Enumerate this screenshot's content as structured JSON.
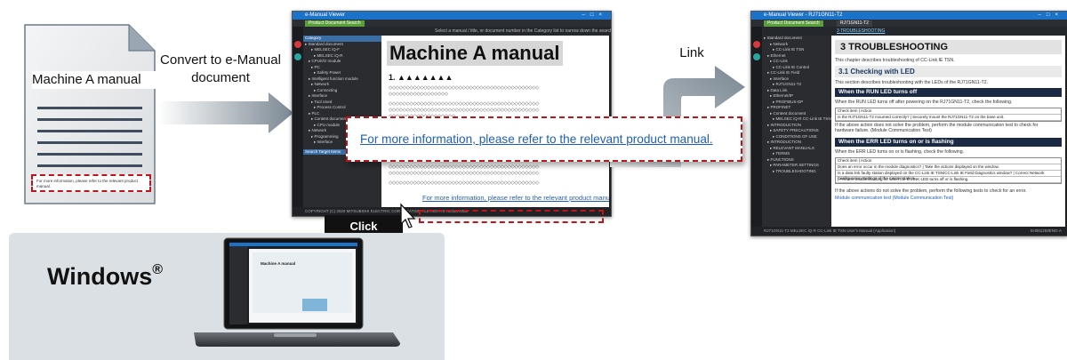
{
  "left_document": {
    "title": "Machine A manual",
    "footer_note": "For more information, please refer to the relevant product manual."
  },
  "steps": {
    "convert_label": "Convert to e-Manual document",
    "link_label": "Link",
    "click_label": "Click"
  },
  "viewer_left": {
    "window_title": "e-Manual Viewer",
    "tab_label": "Product Document Search",
    "toolbar_hint": "Select a manual / title, or document number in the Category list to narrow down the search results. Full-check search...",
    "page_title": "Machine A manual",
    "page_subtitle": "1.  ▲▲▲▲▲▲▲",
    "small_link_text": "For more information, please refer to the relevant product manual.",
    "status_text": "COPYRIGHT (C) 2020 MITSUBISHI ELECTRIC CORPORATION ALL RIGHTS RESERVED",
    "tree_header": "Category",
    "tree_items": [
      "Standard document",
      "MELSEC iQ-F",
      "MELSEC iQ-R",
      "CPU/I/O module",
      "PC",
      "Safety Power",
      "Intelligent function module",
      "Network",
      "Connecting",
      "Interface",
      "Tool Used",
      "Process Control",
      "PLC",
      "Content document",
      "CPU module",
      "Network",
      "Programming",
      "Interface"
    ],
    "tree_footer": "Search Target Items"
  },
  "callout": {
    "text": "For more information, please refer to the relevant product manual."
  },
  "viewer_right": {
    "window_title": "e-Manual Viewer - RJ71GN11-T2",
    "tab_label": "Product Document Search",
    "tab2_label": "RJ71GN11-T2",
    "breadcrumb": "3 TROUBLESHOOTING",
    "h1": "3 TROUBLESHOOTING",
    "intro": "This chapter describes troubleshooting of CC-Link IE TSN.",
    "h2": "3.1 Checking with LED",
    "p2": "This section describes troubleshooting with the LEDs of the RJ71GN11-T2.",
    "h3a": "When the RUN LED turns off",
    "p3a": "When the RUN LED turns off after powering on the RJ71GN11-T2, check the following.",
    "table_a": [
      "Check item  |  Action",
      "Is the RJ71GN11-T2 mounted correctly?  |  Securely mount the RJ71GN11-T2 on the base unit."
    ],
    "p_after_a": "If the above action does not solve the problem, perform the module communication test to check for hardware failure. (Module Communication Test)",
    "h3b": "When the ERR LED turns on or is flashing",
    "p3b": "When the ERR LED turns on or is flashing, check the following.",
    "table_b": [
      "Check item  |  Action",
      "Does an error occur in the module diagnostics?  |  Take the actions displayed on the window.",
      "Is a data link faulty station displayed on the CC-Link IE TSN/CC-Link IE Field Diagnostics window?  |  Correct Network Configuration Settings of the master station.",
      "  |  Perform troubleshooting for when the D LINK LED turns off or is flashing."
    ],
    "p_after_b": "If the above actions do not solve the problem, perform the following tests to check for an error.",
    "bullet": "Module communication test (Module Communication Test)",
    "tree_items": [
      "Standard document",
      "Network",
      "CC-Link IE TSN",
      "Ethernet",
      "CC-Link",
      "CC-Link IE Control",
      "CC-Link IE Field",
      "Interface",
      "RJ71GN11-T2",
      "Data Link",
      "Ethernet/IP",
      "PROFIBUS-DP",
      "PROFINET",
      "Content document",
      "MELSEC iQ-R CC-Link IE TSN User's Manual",
      "INTRODUCTION",
      "SAFETY PRECAUTIONS",
      "CONDITIONS OF USE",
      "INTRODUCTION",
      "RELEVANT MANUALS",
      "TERMS",
      "FUNCTIONS",
      "PARAMETER SETTINGS",
      "TROUBLESHOOTING"
    ],
    "status_text": "RJ71GN11-T2 MELSEC iQ-R CC-Link IE TSN User's Manual (Application)",
    "status_right": "SH081259ENG-A"
  },
  "windows_section": {
    "label": "Windows",
    "reg": "®",
    "laptop_screen_title": "Machine A manual"
  },
  "colors": {
    "accent_red": "#c0141b",
    "link_blue": "#1e5fb4",
    "arrow_gray": "#7a8792",
    "panel_gray": "#dbe0e4"
  }
}
